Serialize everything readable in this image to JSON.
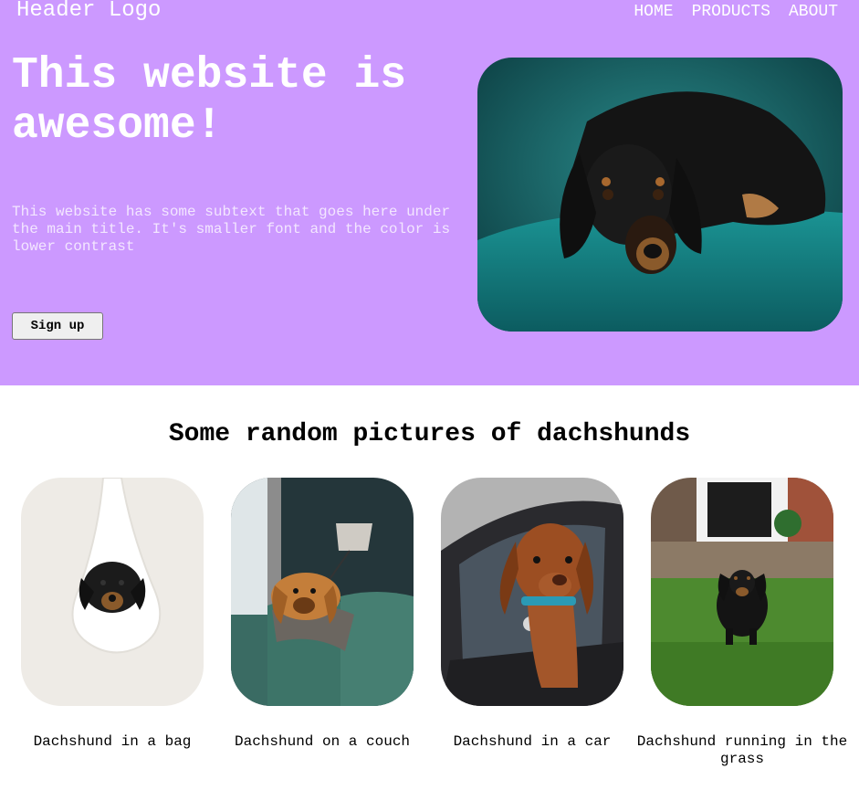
{
  "header": {
    "logo": "Header Logo",
    "nav": [
      "HOME",
      "PRODUCTS",
      "ABOUT"
    ]
  },
  "hero": {
    "title": "This website is awesome!",
    "subtitle": "This website has some subtext that goes here under the main title. It's smaller font and the color is lower contrast",
    "cta_label": "Sign up",
    "image": "dachshund-lying-on-teal-couch"
  },
  "gallery": {
    "title": "Some random pictures of dachshunds",
    "items": [
      {
        "caption": "Dachshund in a bag",
        "image": "dachshund-in-white-bag"
      },
      {
        "caption": "Dachshund on a couch",
        "image": "dachshund-on-green-couch"
      },
      {
        "caption": "Dachshund in a car",
        "image": "dachshund-in-car-window"
      },
      {
        "caption": "Dachshund running in the grass",
        "image": "dachshund-running-grass"
      }
    ]
  },
  "colors": {
    "hero_bg": "#cc99ff",
    "hero_text": "#ffffff",
    "page_bg": "#ffffff"
  }
}
